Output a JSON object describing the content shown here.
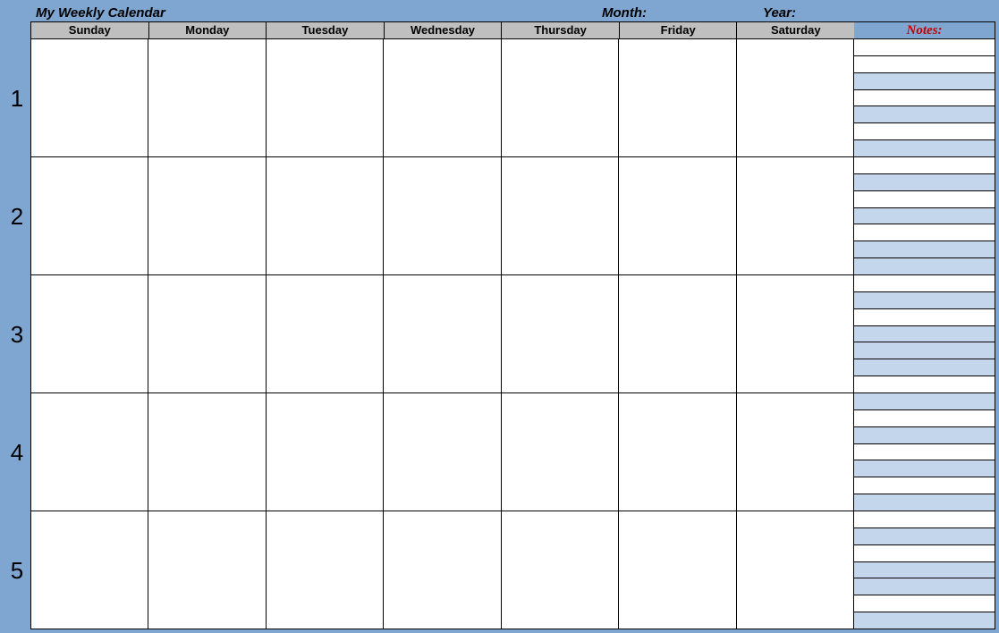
{
  "header": {
    "title": "My Weekly Calendar",
    "month_label": "Month:",
    "year_label": "Year:"
  },
  "days": {
    "sun": "Sunday",
    "mon": "Monday",
    "tue": "Tuesday",
    "wed": "Wednesday",
    "thu": "Thursday",
    "fri": "Friday",
    "sat": "Saturday"
  },
  "notes_header": "Notes:",
  "week_numbers": {
    "w1": "1",
    "w2": "2",
    "w3": "3",
    "w4": "4",
    "w5": "5"
  },
  "colors": {
    "frame": "#7ea6d1",
    "day_header_bg": "#bfbfbf",
    "notes_header_text": "#c00000",
    "notes_alt_bg": "#c3d6ec"
  }
}
